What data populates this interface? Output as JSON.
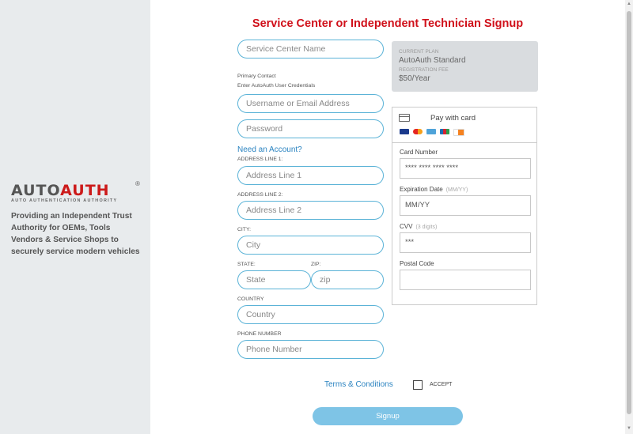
{
  "sidebar": {
    "logo_text_a": "AUTO",
    "logo_text_b": "AUTH",
    "logo_registered": "®",
    "logo_subtitle": "AUTO AUTHENTICATION AUTHORITY",
    "tagline": "Providing an Independent Trust Authority for OEMs, Tools Vendors & Service Shops to securely service modern vehicles"
  },
  "form": {
    "title": "Service Center or Independent Technician Signup",
    "service_center_placeholder": "Service Center Name",
    "primary_contact_label": "Primary Contact",
    "credentials_hint": "Enter AutoAuth User Credentials",
    "username_placeholder": "Username or Email Address",
    "password_placeholder": "Password",
    "need_account_link": "Need an Account?",
    "address1_label": "ADDRESS LINE 1:",
    "address1_placeholder": "Address Line 1",
    "address2_label": "ADDRESS LINE 2:",
    "address2_placeholder": "Address Line 2",
    "city_label": "CITY:",
    "city_placeholder": "City",
    "state_label": "STATE:",
    "state_placeholder": "State",
    "zip_label": "ZIP:",
    "zip_placeholder": "zip",
    "country_label": "COUNTRY",
    "country_placeholder": "Country",
    "phone_label": "PHONE NUMBER",
    "phone_placeholder": "Phone Number",
    "terms_link": "Terms & Conditions",
    "accept_label": "ACCEPT",
    "signup_button": "Signup"
  },
  "plan": {
    "current_plan_label": "CURRENT PLAN",
    "current_plan_value": "AutoAuth Standard",
    "fee_label": "REGISTRATION FEE",
    "fee_value": "$50/Year"
  },
  "payment": {
    "title": "Pay with card",
    "brands": [
      "visa-icon",
      "mastercard-icon",
      "amex-icon",
      "jcb-icon",
      "discover-icon"
    ],
    "card_number_label": "Card Number",
    "card_number_placeholder": "**** **** **** ****",
    "expiration_label": "Expiration Date",
    "expiration_hint": "(MM/YY)",
    "expiration_placeholder": "MM/YY",
    "cvv_label": "CVV",
    "cvv_hint": "(3 digits)",
    "cvv_placeholder": "***",
    "postal_label": "Postal Code",
    "postal_placeholder": ""
  },
  "colors": {
    "accent_red": "#d0101a",
    "link_blue": "#2a83c0",
    "input_border": "#5bb3d7",
    "button_bg": "#7ec4e6",
    "sidebar_bg": "#e8ebed"
  }
}
